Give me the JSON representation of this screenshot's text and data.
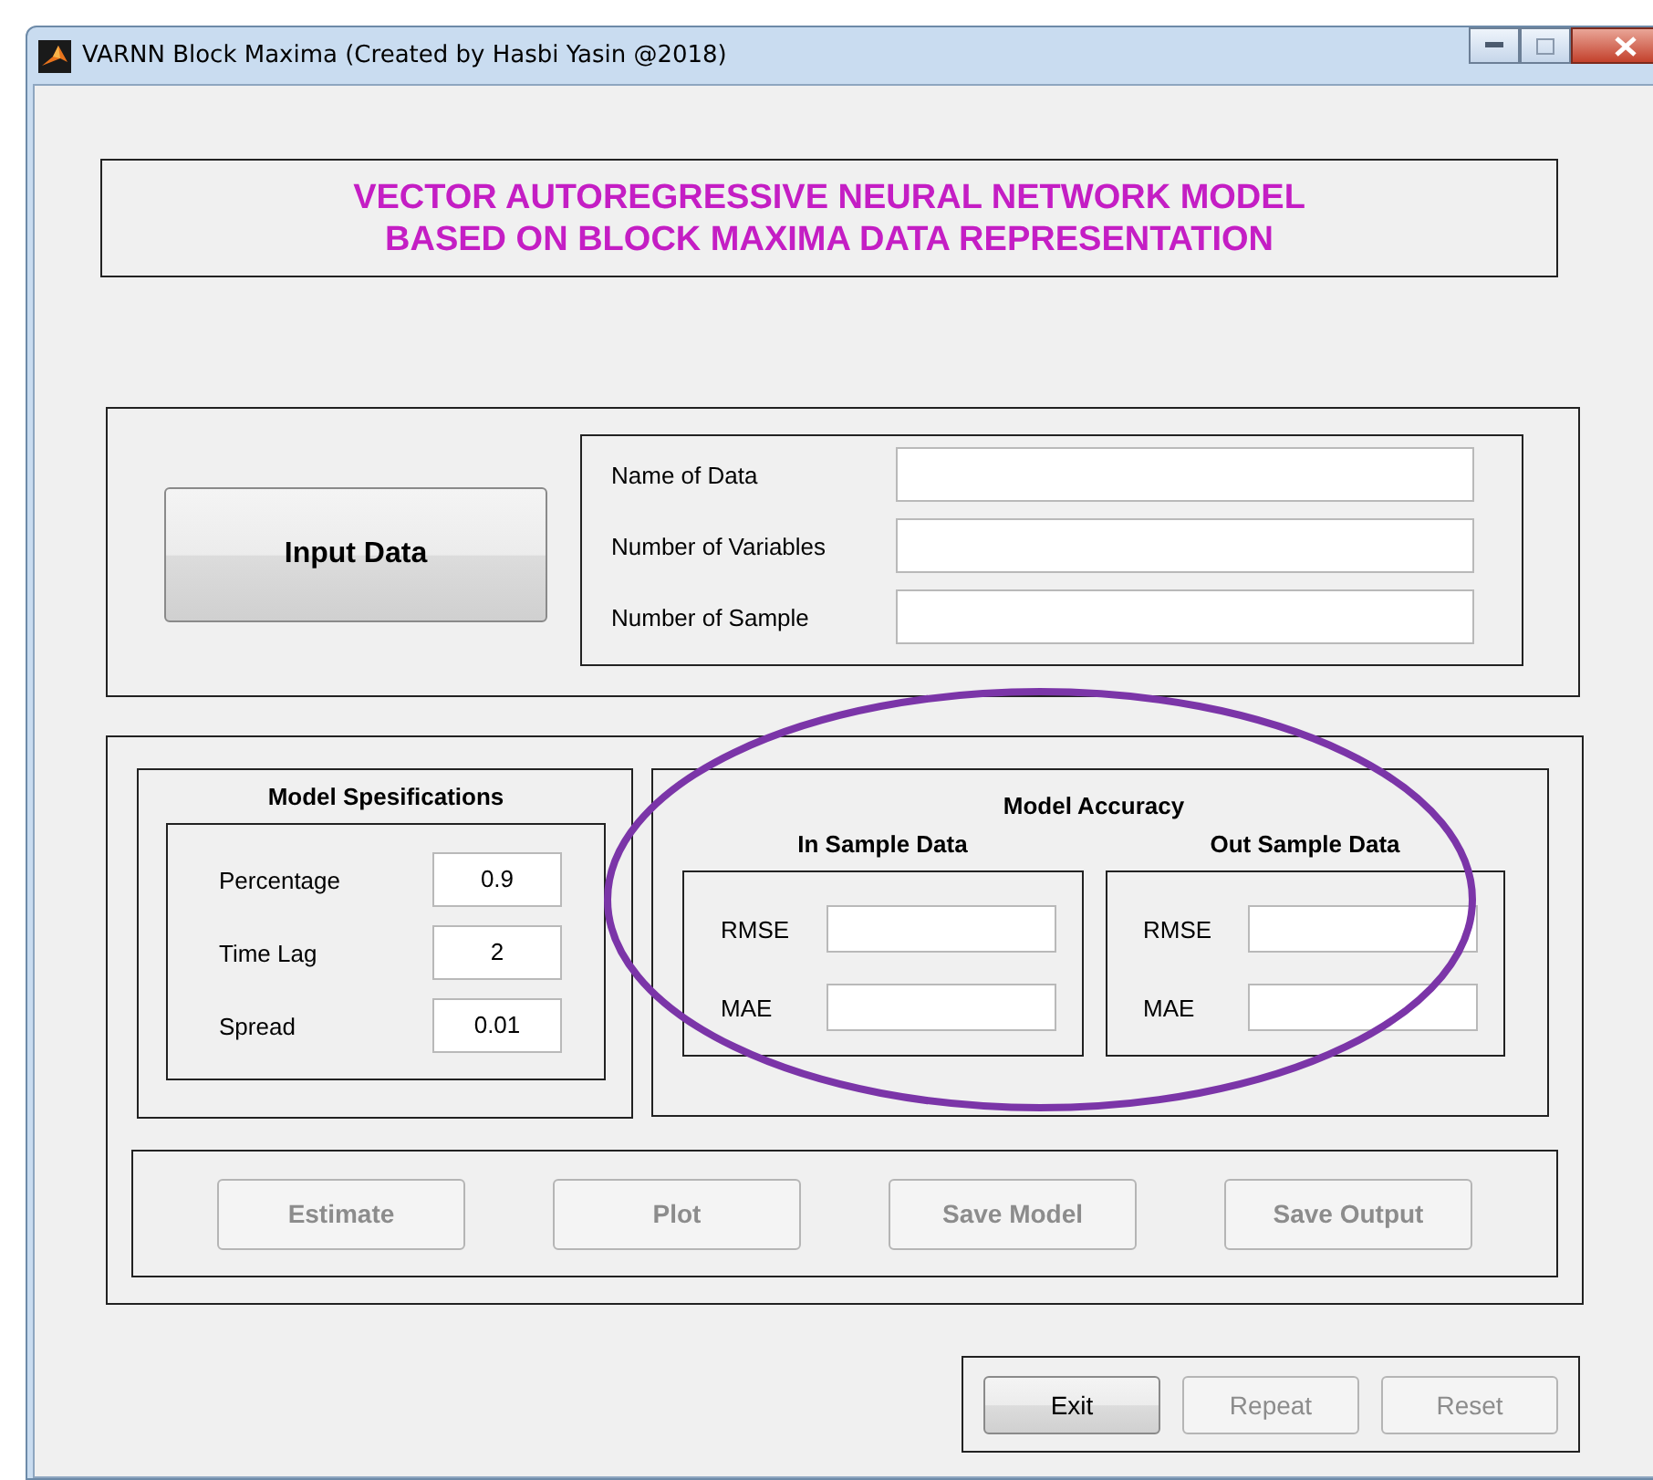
{
  "window": {
    "title": "VARNN Block Maxima (Created by Hasbi Yasin @2018)"
  },
  "header": {
    "lines": [
      "VECTOR AUTOREGRESSIVE NEURAL NETWORK MODEL",
      "BASED ON BLOCK MAXIMA DATA REPRESENTATION"
    ]
  },
  "input_button": {
    "label": "Input Data",
    "disabled": false
  },
  "data_fields": [
    {
      "label": "Name of Data"
    },
    {
      "label": "Number of Variables"
    },
    {
      "label": "Number of Sample"
    }
  ],
  "model_specifications": {
    "title": "Model Spesifications",
    "fields": [
      {
        "label": "Percentage",
        "value": "0.9"
      },
      {
        "label": "Time Lag",
        "value": "2"
      },
      {
        "label": "Spread",
        "value": "0.01"
      }
    ]
  },
  "model_accuracy": {
    "title": "Model Accuracy",
    "groups": [
      {
        "title": "In Sample Data",
        "fields": [
          {
            "label": "RMSE"
          },
          {
            "label": "MAE"
          }
        ]
      },
      {
        "title": "Out Sample Data",
        "fields": [
          {
            "label": "RMSE"
          },
          {
            "label": "MAE"
          }
        ]
      }
    ]
  },
  "action_buttons": [
    {
      "label": "Estimate",
      "disabled": true
    },
    {
      "label": "Plot",
      "disabled": true
    },
    {
      "label": "Save Model",
      "disabled": true
    },
    {
      "label": "Save Output",
      "disabled": true
    }
  ],
  "bottom_buttons": [
    {
      "label": "Exit",
      "disabled": false
    },
    {
      "label": "Repeat",
      "disabled": true
    },
    {
      "label": "Reset",
      "disabled": true
    }
  ]
}
